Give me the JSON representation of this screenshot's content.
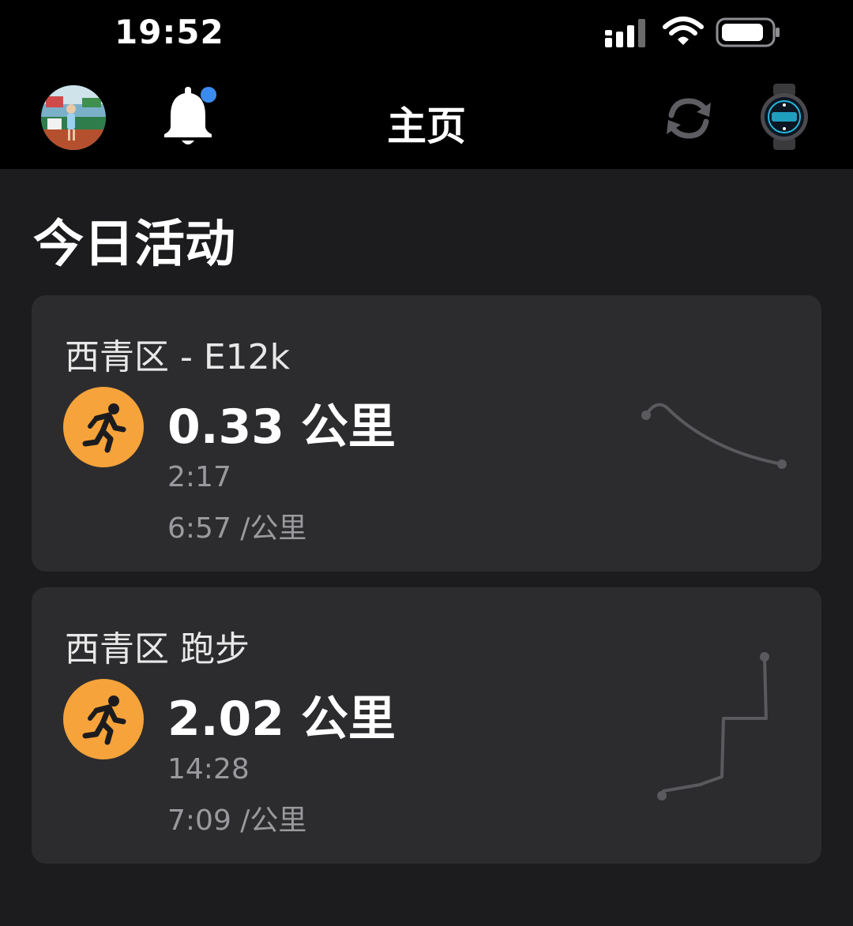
{
  "status_bar": {
    "time": "19:52",
    "signal_icon": "cellular-signal-icon",
    "wifi_icon": "wifi-icon",
    "battery_icon": "battery-icon"
  },
  "header": {
    "title": "主页",
    "avatar": "profile-avatar",
    "notification_icon": "bell-icon",
    "notification_badge_color": "#3b8cf0",
    "sync_icon": "sync-icon",
    "device_icon": "smartwatch-icon"
  },
  "section": {
    "title": "今日活动"
  },
  "activities": [
    {
      "title": "西青区 - E12k",
      "icon": "running-icon",
      "distance": "0.33 公里",
      "duration": "2:17",
      "pace": "6:57 /公里"
    },
    {
      "title": "西青区 跑步",
      "icon": "running-icon",
      "distance": "2.02 公里",
      "duration": "14:28",
      "pace": "7:09 /公里"
    }
  ],
  "colors": {
    "background": "#1c1c1e",
    "card": "#2c2c2e",
    "accent_orange": "#f5a33a",
    "secondary_text": "#9a9a9e"
  }
}
